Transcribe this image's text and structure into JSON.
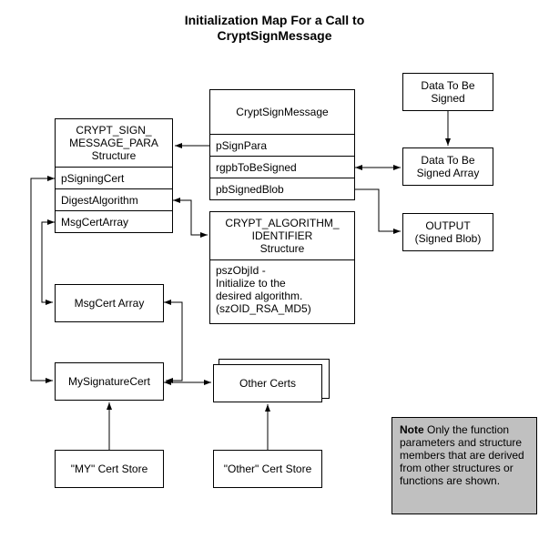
{
  "title_line1": "Initialization Map For a Call to",
  "title_line2": "CryptSignMessage",
  "crypt_sign_msg": {
    "header": "CRYPT_SIGN_\nMESSAGE_PARA\nStructure",
    "rows": [
      "pSigningCert",
      "DigestAlgorithm",
      "MsgCertArray"
    ]
  },
  "crypt_sign_fn": {
    "header": "CryptSignMessage",
    "rows": [
      "pSignPara",
      "rgpbToBeSigned",
      "pbSignedBlob"
    ]
  },
  "crypt_alg": {
    "header": "CRYPT_ALGORITHM_\nIDENTIFIER\nStructure",
    "body": "pszObjId -\nInitialize to the\ndesired algorithm.\n(szOID_RSA_MD5)"
  },
  "data_to_sign": "Data To Be\nSigned",
  "data_array": "Data To Be\nSigned Array",
  "output": "OUTPUT\n(Signed Blob)",
  "msgcert_array": "MsgCert Array",
  "mysig_cert": "MySignatureCert",
  "other_certs": "Other Certs",
  "my_store": "\"MY\" Cert Store",
  "other_store": "\"Other\" Cert Store",
  "note_label": "Note",
  "note_body": "  Only the function parameters and structure members that are derived from other structures or functions are shown."
}
